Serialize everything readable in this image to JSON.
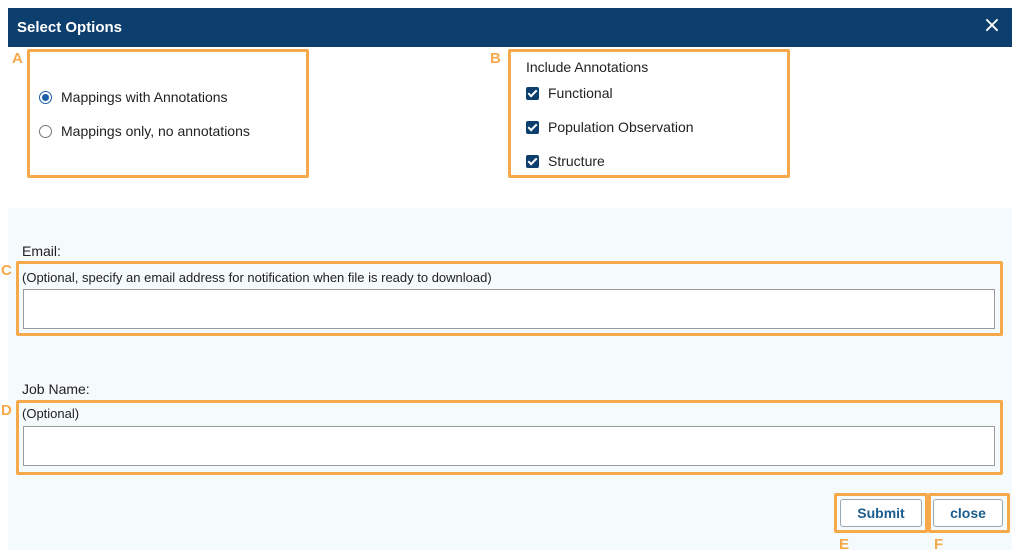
{
  "dialog": {
    "title": "Select Options",
    "close_icon": "close-icon"
  },
  "format": {
    "options": [
      {
        "label": "Mappings with Annotations",
        "selected": true
      },
      {
        "label": "Mappings only, no annotations",
        "selected": false
      }
    ]
  },
  "annotations": {
    "heading": "Include Annotations",
    "items": [
      {
        "label": "Functional",
        "checked": true
      },
      {
        "label": "Population Observation",
        "checked": true
      },
      {
        "label": "Structure",
        "checked": true
      }
    ]
  },
  "email": {
    "label": "Email:",
    "hint": "(Optional, specify an email address for notification when file is ready to download)",
    "value": ""
  },
  "job_name": {
    "label": "Job Name:",
    "hint": "(Optional)",
    "value": ""
  },
  "buttons": {
    "submit": "Submit",
    "close": "close"
  },
  "callouts": {
    "a": "A",
    "b": "B",
    "c": "C",
    "d": "D",
    "e": "E",
    "f": "F"
  },
  "colors": {
    "header": "#0d3f6e",
    "callout": "#f6a94b",
    "button_text": "#1a5d8f",
    "panel": "#f5fafc"
  }
}
